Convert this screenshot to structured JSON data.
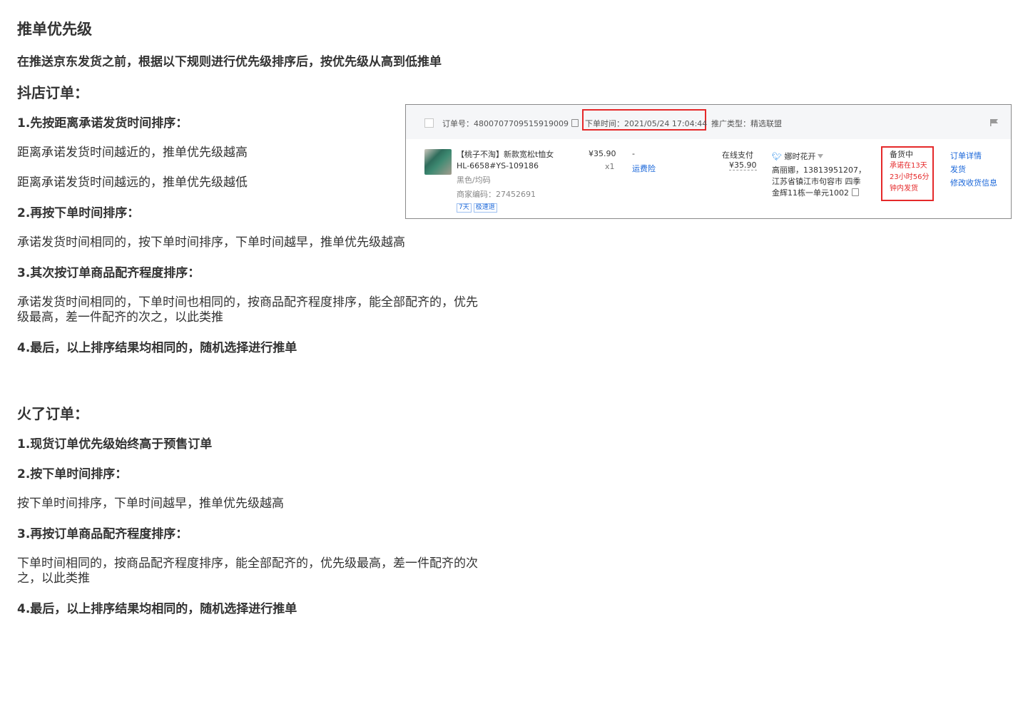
{
  "title": "推单优先级",
  "intro": "在推送京东发货之前，根据以下规则进行优先级排序后，按优先级从高到低推单",
  "doudian": {
    "heading": "抖店订单：",
    "rule1_title": "1.先按距离承诺发货时间排序：",
    "rule1_line1": "距离承诺发货时间越近的，推单优先级越高",
    "rule1_line2": "距离承诺发货时间越远的，推单优先级越低",
    "rule2_title": "2.再按下单时间排序：",
    "rule2_text": "承诺发货时间相同的，按下单时间排序，下单时间越早，推单优先级越高",
    "rule3_title": "3.其次按订单商品配齐程度排序：",
    "rule3_text": "承诺发货时间相同的，下单时间也相同的，按商品配齐程度排序，能全部配齐的，优先级最高，差一件配齐的次之，以此类推",
    "rule4_title": "4.最后，以上排序结果均相同的，随机选择进行推单"
  },
  "huole": {
    "heading": "火了订单：",
    "rule1_title": "1.现货订单优先级始终高于预售订单",
    "rule2_title": "2.按下单时间排序：",
    "rule2_text": "按下单时间排序，下单时间越早，推单优先级越高",
    "rule3_title": "3.再按订单商品配齐程度排序：",
    "rule3_text": "下单时间相同的，按商品配齐程度排序，能全部配齐的，优先级最高，差一件配齐的次之，以此类推",
    "rule4_title": "4.最后，以上排序结果均相同的，随机选择进行推单"
  },
  "order_card": {
    "order_no": "订单号：4800707709515919009",
    "order_time": "下单时间：2021/05/24 17:04:44",
    "promo_type": "推广类型：精选联盟",
    "product_name": "【桃子不淘】新款宽松t恤女HL-6658#YS-109186",
    "product_spec": "黑色/均码",
    "merchant_code": "商家编码：27452691",
    "tags": [
      "7天",
      "极速退"
    ],
    "price": "¥35.90",
    "quantity": "x1",
    "dash": "-",
    "insurance": "运费险",
    "pay_method": "在线支付",
    "pay_amount": "¥35.90",
    "buyer": "娜时花开",
    "address": "高丽娜，13813951207，江苏省镇江市句容市 四季金辉11栋一单元1002",
    "status": "备货中",
    "status_note": [
      "承诺在13天",
      "23小时56分",
      "钟内发货"
    ],
    "actions": [
      "订单详情",
      "发货",
      "修改收货信息"
    ],
    "colors": {
      "highlight": "#e5292a",
      "link": "#1966d9"
    },
    "icons": [
      "copy-icon",
      "flag-icon",
      "bird-icon",
      "filter-icon"
    ]
  }
}
